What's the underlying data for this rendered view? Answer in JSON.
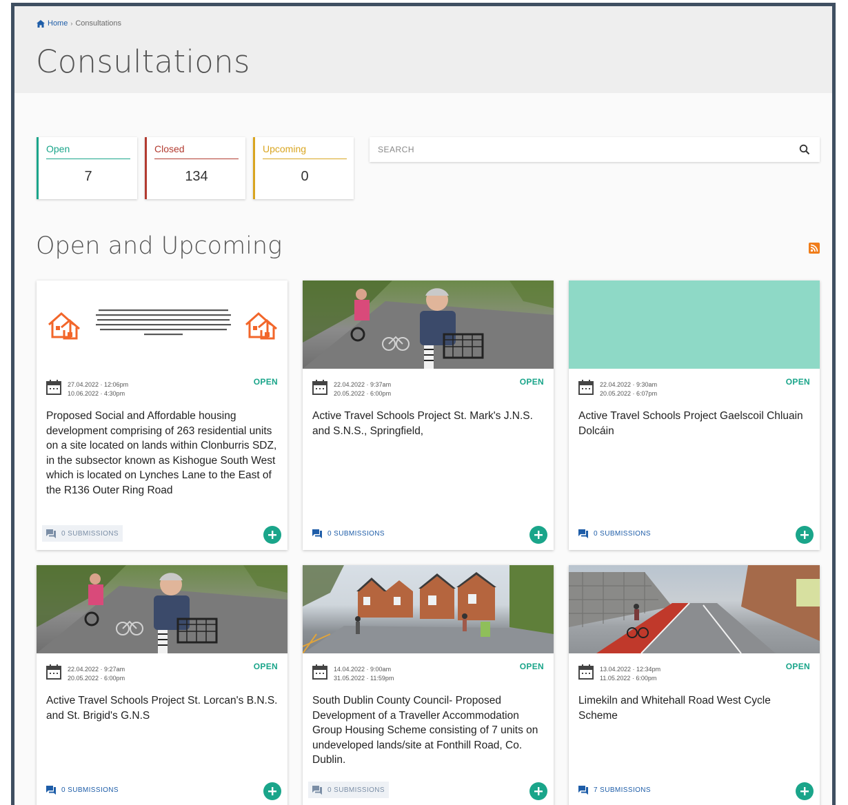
{
  "breadcrumb": {
    "home": "Home",
    "separator": "›",
    "current": "Consultations"
  },
  "page_title": "Consultations",
  "stats": [
    {
      "label": "Open",
      "count": "7",
      "color": "#1aa58a"
    },
    {
      "label": "Closed",
      "count": "134",
      "color": "#b23a2f"
    },
    {
      "label": "Upcoming",
      "count": "0",
      "color": "#d9a520"
    }
  ],
  "search": {
    "placeholder": "SEARCH"
  },
  "section_title": "Open and Upcoming",
  "colors": {
    "open": "#1aa58a",
    "submissions": "#1e5da8",
    "rss": "#f07d1a",
    "teal_placeholder": "#8ed9c6"
  },
  "cards": [
    {
      "start": "27.04.2022 · 12:06pm",
      "end": "10.06.2022 · 4:30pm",
      "status": "OPEN",
      "title": "Proposed Social and Affordable housing development comprising of 263 residential units on a site located on lands within Clonburris SDZ, in the subsector known as Kishogue South West which is located on Lynches Lane to the East of the R136 Outer Ring Road",
      "submissions": "0 SUBMISSIONS",
      "image": "house-banner"
    },
    {
      "start": "22.04.2022 · 9:37am",
      "end": "20.05.2022 · 6:00pm",
      "status": "OPEN",
      "title": "Active Travel Schools Project St. Mark's J.N.S. and S.N.S., Springfield,",
      "submissions": "0 SUBMISSIONS",
      "image": "cyclists-photo"
    },
    {
      "start": "22.04.2022 · 9:30am",
      "end": "20.05.2022 · 6:07pm",
      "status": "OPEN",
      "title": "Active Travel Schools Project Gaelscoil Chluain Dolcáin",
      "submissions": "0 SUBMISSIONS",
      "image": "teal-placeholder"
    },
    {
      "start": "22.04.2022 · 9:27am",
      "end": "20.05.2022 · 6:00pm",
      "status": "OPEN",
      "title": "Active Travel Schools Project St. Lorcan's B.N.S. and St. Brigid's G.N.S",
      "submissions": "0 SUBMISSIONS",
      "image": "cyclists-photo"
    },
    {
      "start": "14.04.2022 · 9:00am",
      "end": "31.05.2022 · 11:59pm",
      "status": "OPEN",
      "title": "South Dublin County Council- Proposed Development of a Traveller Accommodation Group Housing Scheme consisting of 7 units on undeveloped lands/site at Fonthill Road, Co. Dublin.",
      "submissions": "0 SUBMISSIONS",
      "image": "housing-render"
    },
    {
      "start": "13.04.2022 · 12:34pm",
      "end": "11.05.2022 · 6:00pm",
      "status": "OPEN",
      "title": "Limekiln and Whitehall Road West Cycle Scheme",
      "submissions": "7 SUBMISSIONS",
      "image": "cycle-lane-render"
    }
  ]
}
